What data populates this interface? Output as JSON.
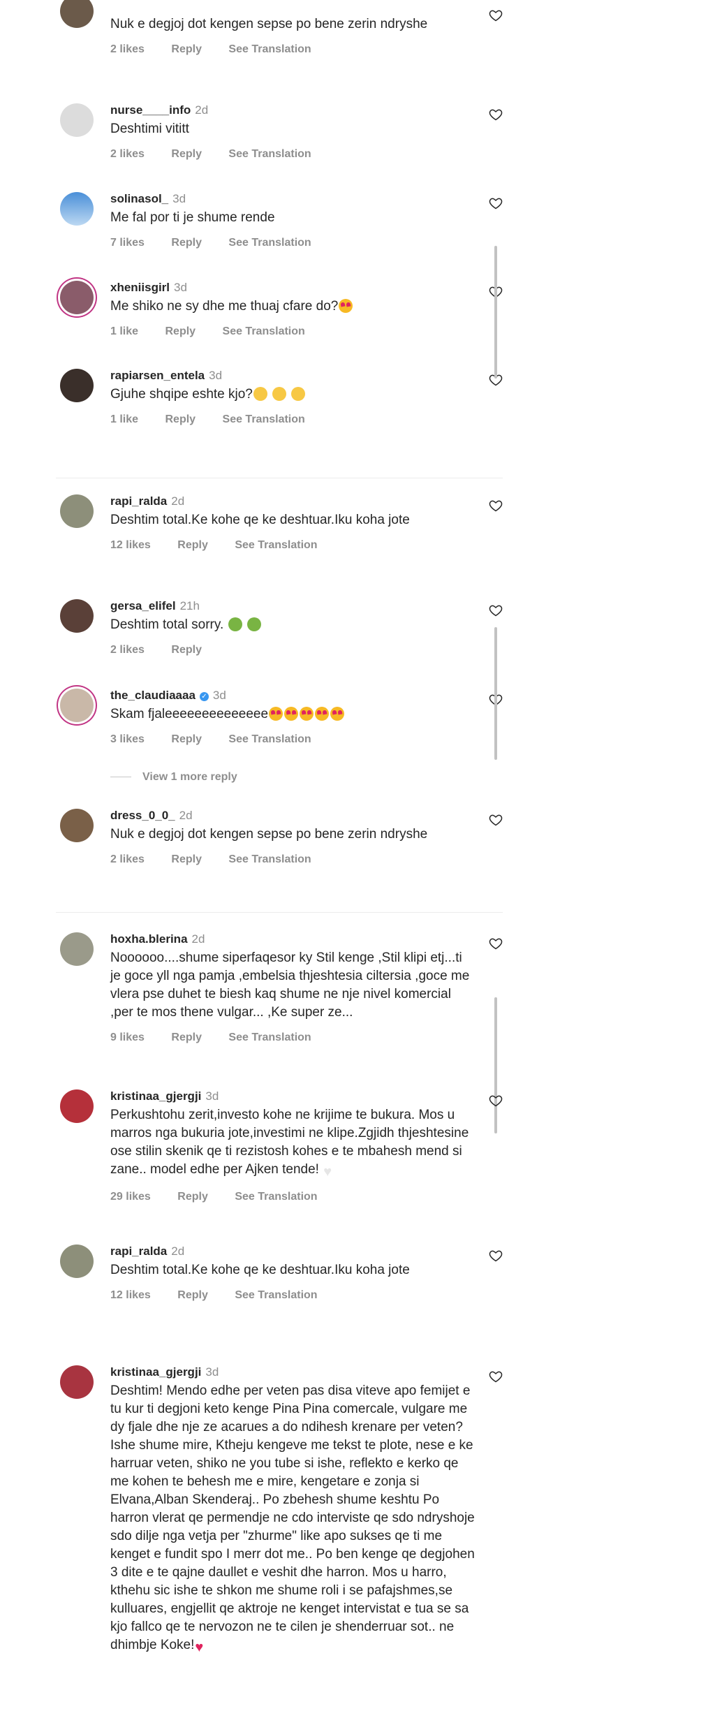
{
  "labels": {
    "reply": "Reply",
    "see_translation": "See Translation"
  },
  "icons": {
    "like": "heart-outline-icon",
    "verified": "verified-badge-icon"
  },
  "colors": {
    "username": "#262626",
    "meta": "#8e8e8e",
    "verified": "#3897f0",
    "heart": "#e0245e"
  },
  "view_more": "View 1 more reply",
  "comments": [
    {
      "username": "",
      "time": "",
      "text": "Nuk e degjoj dot kengen sepse po bene zerin ndryshe",
      "likes": "2 likes",
      "translation": true
    },
    {
      "username": "nurse____info",
      "time": "2d",
      "text": "Deshtimi vititt",
      "likes": "2 likes",
      "translation": true
    },
    {
      "username": "solinasol_",
      "time": "3d",
      "text": "Me fal por ti je shume rende",
      "likes": "7 likes",
      "translation": true
    },
    {
      "username": "xheniisgirl",
      "time": "3d",
      "text": "Me shiko ne sy dhe me thuaj cfare do?",
      "likes": "1 like",
      "translation": true
    },
    {
      "username": "rapiarsen_entela",
      "time": "3d",
      "text": "Gjuhe shqipe eshte kjo?",
      "likes": "1 like",
      "translation": true
    },
    {
      "username": "rapi_ralda",
      "time": "2d",
      "text": "Deshtim total.Ke kohe qe ke deshtuar.Iku koha jote",
      "likes": "12 likes",
      "translation": true
    },
    {
      "username": "gersa_elifel",
      "time": "21h",
      "text": "Deshtim total sorry.",
      "likes": "2 likes",
      "translation": false
    },
    {
      "username": "the_claudiaaaa",
      "time": "3d",
      "text": "Skam fjaleeeeeeeeeeeeee",
      "likes": "3 likes",
      "translation": true
    },
    {
      "username": "dress_0_0_",
      "time": "2d",
      "text": "Nuk e degjoj dot kengen sepse po bene zerin ndryshe",
      "likes": "2 likes",
      "translation": true
    },
    {
      "username": "hoxha.blerina",
      "time": "2d",
      "text": "Noooooo....shume siperfaqesor ky Stil kenge ,Stil klipi etj...ti je goce yll nga pamja ,embelsia thjeshtesia ciltersia ,goce me vlera pse duhet te biesh kaq shume ne nje nivel komercial ,per te mos thene vulgar... ,Ke super ze...",
      "likes": "9 likes",
      "translation": true
    },
    {
      "username": "kristinaa_gjergji",
      "time": "3d",
      "text": "Perkushtohu zerit,investo kohe ne krijime te bukura. Mos u marros nga bukuria jote,investimi ne klipe.Zgjidh thjeshtesine ose stilin skenik qe ti rezistosh kohes e te mbahesh mend si zane.. model edhe per Ajken tende!",
      "likes": "29 likes",
      "translation": true
    },
    {
      "username": "rapi_ralda",
      "time": "2d",
      "text": "Deshtim total.Ke kohe qe ke deshtuar.Iku koha jote",
      "likes": "12 likes",
      "translation": true
    },
    {
      "username": "kristinaa_gjergji",
      "time": "3d",
      "text": "Deshtim! Mendo edhe per veten pas disa viteve apo femijet e tu kur ti degjoni keto kenge Pina Pina comercale, vulgare me dy fjale dhe nje ze acarues a do ndihesh krenare per veten? Ishe shume mire, Ktheju kengeve me tekst te plote, nese e ke harruar veten, shiko ne you tube si ishe, reflekto e kerko qe me kohen te behesh me e mire, kengetare e zonja si Elvana,Alban Skenderaj.. Po zbehesh shume keshtu Po harron vlerat qe permendje ne cdo interviste qe sdo ndryshoje sdo dilje nga vetja per \"zhurme\" like apo sukses qe ti me kenget e fundit spo I merr dot me.. Po ben kenge qe degjohen 3 dite e te qajne daullet e veshit dhe harron. Mos u harro, kthehu sic ishe te shkon me shume roli i se pafajshmes,se kulluares, engjellit qe aktroje ne kenget intervistat e tua se sa kjo fallco qe te nervozon ne te cilen je shenderruar sot.. ne dhimbje Koke!",
      "likes": "",
      "translation": false
    }
  ]
}
